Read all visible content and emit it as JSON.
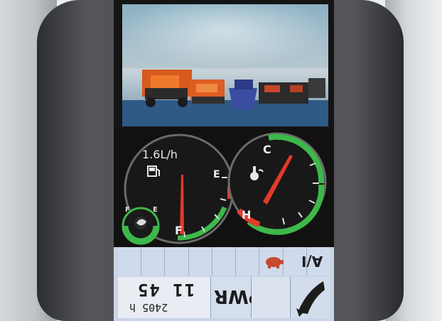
{
  "camera": {
    "label": "rear camera view"
  },
  "gauges": {
    "fuel": {
      "rate_text": "1.6L/h",
      "full_label": "F",
      "empty_label": "E",
      "level_fraction": 0.55
    },
    "coolant": {
      "cold_label": "C",
      "hot_label": "H",
      "level_fraction": 0.35
    },
    "eco": {
      "full_label": "F",
      "empty_label": "E"
    }
  },
  "status_row": {
    "auto_idle_label": "A/I",
    "icons": [
      "turtle-icon"
    ]
  },
  "bottom": {
    "clock_time": "11 45",
    "hour_meter": "2405 h",
    "power_mode_label": "PWR",
    "work_mode_icon": "bucket-icon"
  },
  "colors": {
    "needle": "#e23a2a",
    "green_zone": "#3db84a",
    "red_zone": "#e43b2d",
    "panel": "#c9d4e6"
  }
}
